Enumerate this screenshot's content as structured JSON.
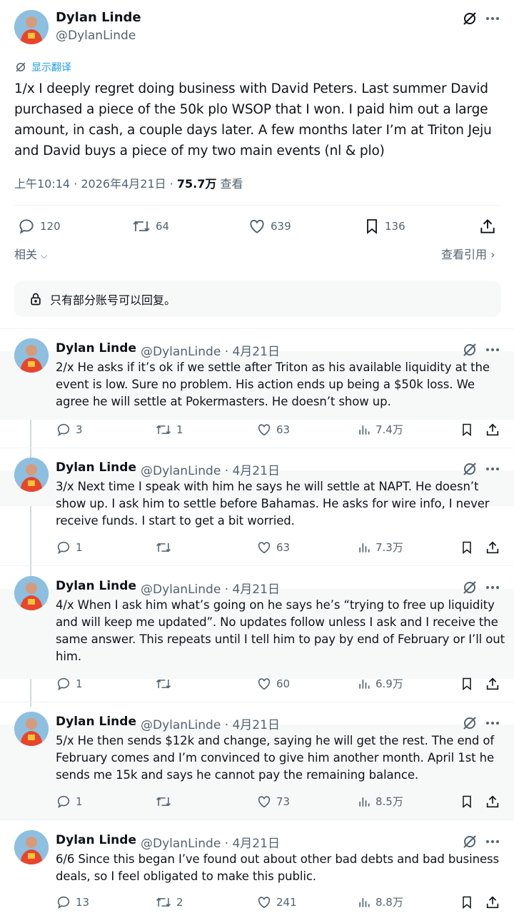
{
  "main_tweet": {
    "author_name": "Dylan Linde",
    "author_handle": "@DylanLinde",
    "translate_label": "显示翻译",
    "text": "1/x I deeply regret doing business with David Peters.  Last summer David purchased a piece of the 50k plo WSOP that I won.  I paid him out a large amount, in cash, a couple days later.  A few months later I’m at Triton Jeju and David buys a piece of my two main events (nl & plo)",
    "time": "上午10:14 · 2026年4月21日 · ",
    "views": "75.7万",
    "views_label": " 查看",
    "replies": "120",
    "retweets": "64",
    "likes": "639",
    "bookmarks": "136",
    "related_label": "相关",
    "quotes_label": "查看引用"
  },
  "reply_restriction": "只有部分账号可以回复。",
  "replies": [
    {
      "name": "Dylan Linde",
      "handle_date": "@DylanLinde · 4月21日",
      "text": "2/x He asks if it’s ok if we settle after Triton as his available liquidity at the event is low.  Sure no problem.  His action ends up being a $50k loss.  We agree he will settle at Pokermasters.  He doesn’t show up.",
      "replies": "3",
      "retweets": "1",
      "likes": "63",
      "views": "7.4万"
    },
    {
      "name": "Dylan Linde",
      "handle_date": "@DylanLinde · 4月21日",
      "text": "3/x Next time I speak with him he says he will settle at NAPT.  He doesn’t show up.  I ask him to settle before Bahamas.  He asks for wire info,  I never receive funds.  I start to get a bit worried.",
      "replies": "1",
      "retweets": "",
      "likes": "63",
      "views": "7.3万"
    },
    {
      "name": "Dylan Linde",
      "handle_date": "@DylanLinde · 4月21日",
      "text": "4/x When I ask him what’s going on he says he’s “trying to free up liquidity and will keep me updated”.  No updates follow unless I ask and I receive the same answer.  This repeats until I tell him to pay by end of February or I’ll out him.",
      "replies": "1",
      "retweets": "",
      "likes": "60",
      "views": "6.9万"
    },
    {
      "name": "Dylan Linde",
      "handle_date": "@DylanLinde · 4月21日",
      "text": "5/x He then sends $12k and change, saying he will get the rest.  The end of February comes and I’m convinced to give him another month.  April 1st he sends me 15k and says he cannot pay the remaining balance.",
      "replies": "1",
      "retweets": "",
      "likes": "73",
      "views": "8.5万"
    },
    {
      "name": "Dylan Linde",
      "handle_date": "@DylanLinde · 4月21日",
      "text": "6/6 Since this began I’ve found out about other bad debts and bad business deals, so I feel obligated to make this public.",
      "replies": "13",
      "retweets": "2",
      "likes": "241",
      "views": "8.8万"
    }
  ],
  "icons": {
    "grok": "grok-icon",
    "more": "more-icon",
    "reply": "reply-icon",
    "retweet": "retweet-icon",
    "like": "like-icon",
    "bookmark": "bookmark-icon",
    "share": "share-icon",
    "views": "views-icon",
    "lock": "lock-icon",
    "translate": "translate-icon"
  },
  "colors": {
    "accent": "#1d9bf0",
    "muted": "#536471",
    "text": "#0f1419",
    "band": "#f7f9f9"
  }
}
